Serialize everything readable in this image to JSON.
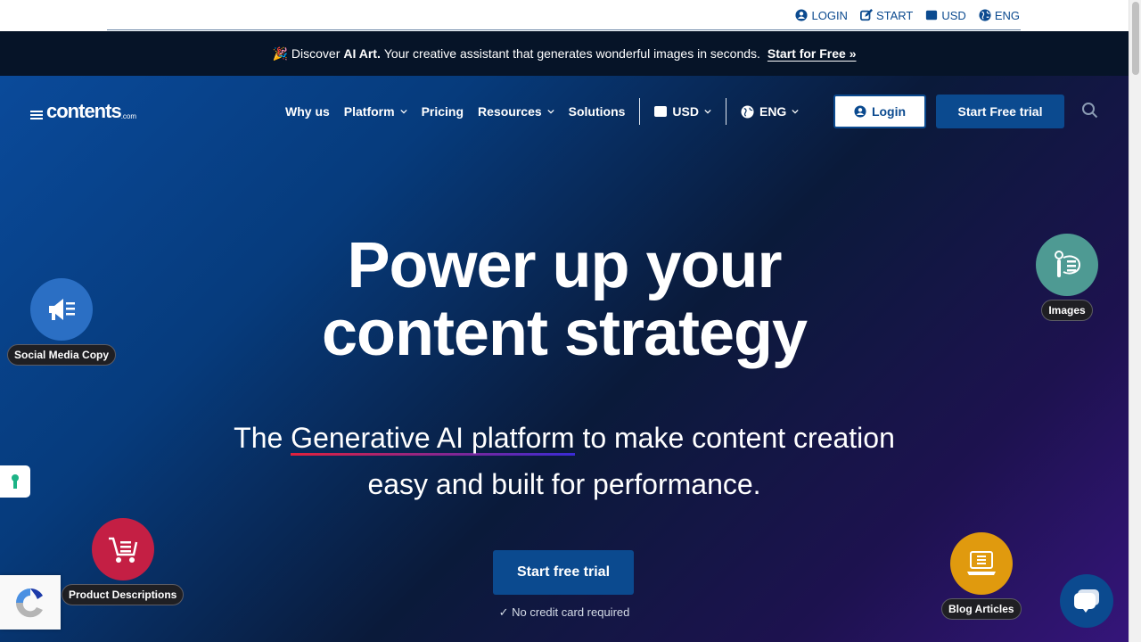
{
  "topbar": {
    "links": [
      {
        "label": "LOGIN",
        "icon": "user-circle-icon"
      },
      {
        "label": "START",
        "icon": "edit-icon"
      },
      {
        "label": "USD",
        "icon": "wallet-icon"
      },
      {
        "label": "ENG",
        "icon": "globe-icon"
      }
    ]
  },
  "announcement": {
    "emoji": "🎉",
    "prefix": "Discover",
    "highlight": "AI Art.",
    "text": "Your creative assistant that generates wonderful images in seconds.",
    "link": "Start for Free »"
  },
  "header": {
    "logo": {
      "word": "contents",
      "suffix": ".com"
    },
    "nav": [
      {
        "label": "Why us",
        "dropdown": false
      },
      {
        "label": "Platform",
        "dropdown": true
      },
      {
        "label": "Pricing",
        "dropdown": false
      },
      {
        "label": "Resources",
        "dropdown": true
      },
      {
        "label": "Solutions",
        "dropdown": false
      }
    ],
    "currency": "USD",
    "language": "ENG",
    "login_label": "Login",
    "trial_label": "Start Free trial"
  },
  "hero": {
    "title_line1": "Power up your",
    "title_line2": "content strategy",
    "subtitle_pre": "The",
    "subtitle_highlight": "Generative AI platform",
    "subtitle_post": "to make content creation",
    "subtitle_line2": "easy and built for performance.",
    "cta_label": "Start free trial",
    "note": "✓ No credit card required"
  },
  "features": [
    {
      "label": "Social Media Copy",
      "color": "#2b6fc4",
      "icon": "megaphone-icon"
    },
    {
      "label": "Images",
      "color": "#4e9a93",
      "icon": "paint-brush-icon"
    },
    {
      "label": "Product Descriptions",
      "color": "#c41f44",
      "icon": "shopping-cart-icon"
    },
    {
      "label": "Blog Articles",
      "color": "#e09a0e",
      "icon": "laptop-icon"
    }
  ],
  "colors": {
    "brand": "#0b4a8f",
    "announce_bg": "#061428"
  }
}
